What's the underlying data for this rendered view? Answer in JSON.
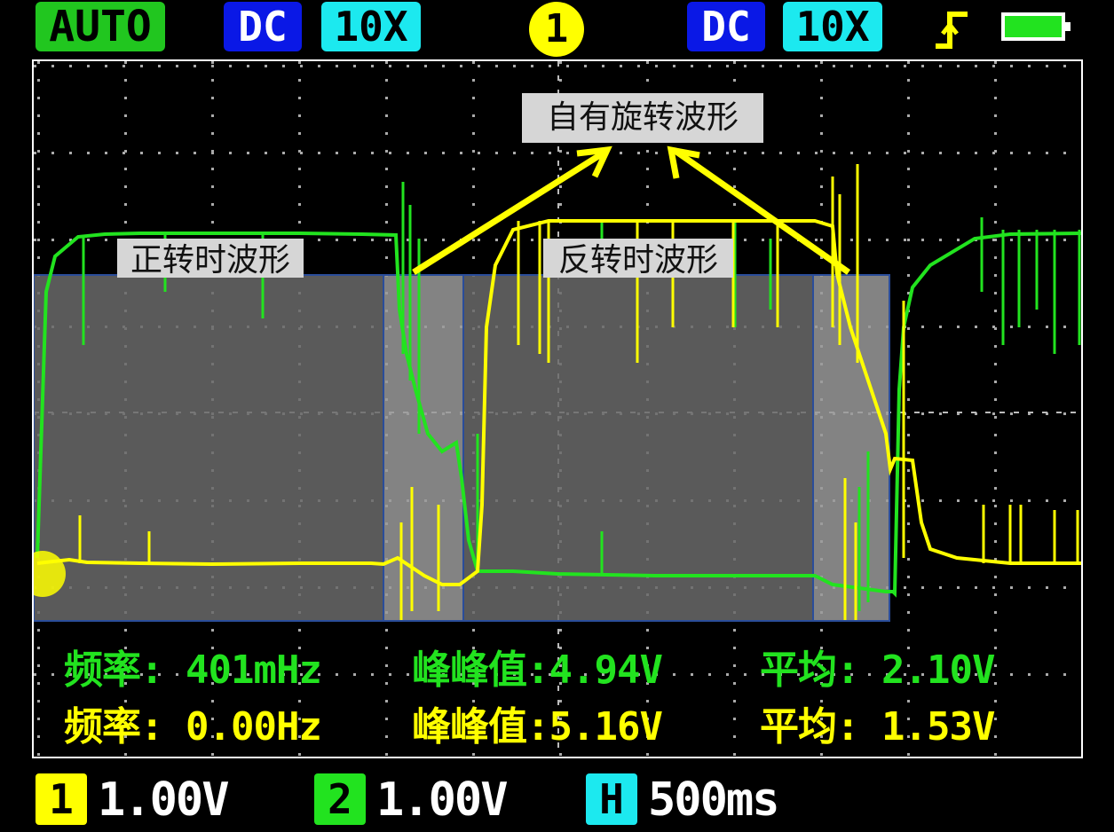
{
  "status_bar": {
    "mode": "AUTO",
    "ch1_coupling": "DC",
    "ch1_probe": "10X",
    "trigger_channel": "1",
    "ch2_coupling": "DC",
    "ch2_probe": "10X",
    "trigger_edge_icon": "rising-edge-icon",
    "battery_icon": "battery-full-icon"
  },
  "annotations": {
    "self_rotation": "自有旋转波形",
    "forward": "正转时波形",
    "reverse": "反转时波形"
  },
  "measurements": {
    "ch2": {
      "freq": "频率: 401mHz",
      "pkpk": "峰峰值:4.94V",
      "avg": "平均: 2.10V"
    },
    "ch1": {
      "freq": "频率: 0.00Hz",
      "pkpk": "峰峰值:5.16V",
      "avg": "平均: 1.53V"
    }
  },
  "scales": {
    "ch1_label": "1",
    "ch1_value": "1.00V",
    "ch2_label": "2",
    "ch2_value": "1.00V",
    "h_label": "H",
    "h_value": "500ms"
  },
  "colors": {
    "ch1": "#ffff00",
    "ch2": "#22e31f",
    "auto": "#21c61f",
    "dc": "#0a18e6",
    "probe": "#1ce9ef"
  }
}
